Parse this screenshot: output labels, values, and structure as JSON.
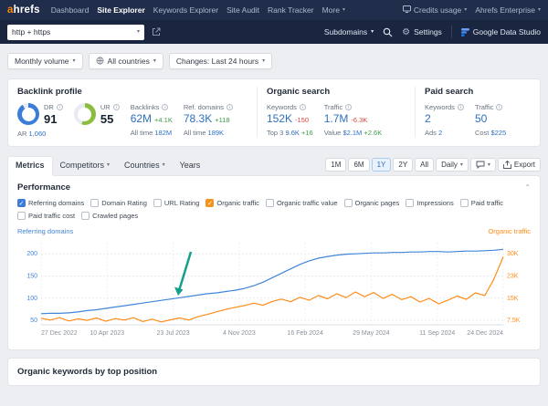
{
  "colors": {
    "accent_orange": "#ff8a00",
    "link_blue": "#2e6fc0",
    "nav_bg": "#212e4b",
    "positive_green": "#3f9b45",
    "negative_red": "#d64541"
  },
  "navbar": {
    "logo_a": "a",
    "logo_rest": "hrefs",
    "items": [
      {
        "label": "Dashboard"
      },
      {
        "label": "Site Explorer",
        "active": true
      },
      {
        "label": "Keywords Explorer"
      },
      {
        "label": "Site Audit"
      },
      {
        "label": "Rank Tracker"
      },
      {
        "label": "More",
        "caret": true
      }
    ],
    "right_items": [
      {
        "label": "Credits usage",
        "caret": true,
        "icon": "screen"
      },
      {
        "label": "Ahrefs Enterprise",
        "caret": true
      }
    ]
  },
  "toolbar": {
    "url_mode": "http + https",
    "scope": "Subdomains",
    "settings_label": "Settings",
    "gds_label": "Google Data Studio"
  },
  "filters": [
    {
      "label": "Monthly volume"
    },
    {
      "label": "All countries",
      "icon": "globe"
    },
    {
      "label": "Changes: Last 24 hours"
    }
  ],
  "overview": {
    "backlink_profile": {
      "title": "Backlink profile",
      "dr_label": "DR",
      "dr_value": "91",
      "dr_percent": 91,
      "dr_color": "#3b7dd8",
      "ar_label": "AR",
      "ar_value": "1,060",
      "ur_label": "UR",
      "ur_value": "55",
      "ur_percent": 55,
      "ur_color": "#8bbd3f",
      "backlinks_label": "Backlinks",
      "backlinks_value": "62M",
      "backlinks_delta": "+4.1K",
      "backlinks_alltime_label": "All time",
      "backlinks_alltime": "182M",
      "refdomains_label": "Ref. domains",
      "refdomains_value": "78.3K",
      "refdomains_delta": "+118",
      "refdomains_alltime_label": "All time",
      "refdomains_alltime": "189K"
    },
    "organic_search": {
      "title": "Organic search",
      "keywords_label": "Keywords",
      "keywords_value": "152K",
      "keywords_delta": "-150",
      "keywords_sub_label": "Top 3",
      "keywords_sub_value": "9.6K",
      "keywords_sub_delta": "+16",
      "traffic_label": "Traffic",
      "traffic_value": "1.7M",
      "traffic_delta": "-6.3K",
      "traffic_sub_label": "Value",
      "traffic_sub_value": "$2.1M",
      "traffic_sub_delta": "+2.6K"
    },
    "paid_search": {
      "title": "Paid search",
      "keywords_label": "Keywords",
      "keywords_value": "2",
      "keywords_sub_label": "Ads",
      "keywords_sub_value": "2",
      "traffic_label": "Traffic",
      "traffic_value": "50",
      "traffic_sub_label": "Cost",
      "traffic_sub_value": "$225"
    }
  },
  "tabs": [
    {
      "label": "Metrics",
      "active": true
    },
    {
      "label": "Competitors",
      "caret": true
    },
    {
      "label": "Countries",
      "caret": true
    },
    {
      "label": "Years"
    }
  ],
  "chart_controls": {
    "ranges": [
      "1M",
      "6M",
      "1Y",
      "2Y",
      "All"
    ],
    "active_range": "1Y",
    "granularity": "Daily",
    "export_label": "Export"
  },
  "performance": {
    "title": "Performance",
    "checkboxes": [
      {
        "label": "Referring domains",
        "checked": true,
        "color": "#3b7dd8"
      },
      {
        "label": "Domain Rating",
        "checked": false
      },
      {
        "label": "URL Rating",
        "checked": false
      },
      {
        "label": "Organic traffic",
        "checked": true,
        "color": "#f5921e"
      },
      {
        "label": "Organic traffic value",
        "checked": false
      },
      {
        "label": "Organic pages",
        "checked": false
      },
      {
        "label": "Impressions",
        "checked": false
      },
      {
        "label": "Paid traffic",
        "checked": false
      },
      {
        "label": "Paid traffic cost",
        "checked": false
      },
      {
        "label": "Crawled pages",
        "checked": false
      }
    ]
  },
  "chart_data": {
    "type": "line",
    "x_labels": [
      "27 Dec 2022",
      "10 Apr 2023",
      "23 Jul 2023",
      "4 Nov 2023",
      "16 Feb 2024",
      "29 May 2024",
      "11 Sep 2024",
      "24 Dec 2024"
    ],
    "left_axis": {
      "label": "Referring domains",
      "color": "#4285d8",
      "ticks": [
        50,
        100,
        150,
        200
      ],
      "range": [
        40,
        225
      ]
    },
    "right_axis": {
      "label": "Organic traffic",
      "color": "#ff8c1a",
      "ticks": [
        "7.5K",
        "15K",
        "23K",
        "30K"
      ],
      "range": [
        6,
        33.75
      ]
    },
    "series": [
      {
        "name": "Referring domains",
        "axis": "left",
        "color": "#4285d8",
        "values": [
          65,
          66,
          66,
          67,
          69,
          72,
          74,
          77,
          80,
          83,
          86,
          89,
          92,
          95,
          98,
          101,
          104,
          107,
          110,
          112,
          115,
          118,
          122,
          128,
          136,
          146,
          156,
          166,
          176,
          184,
          190,
          194,
          197,
          199,
          200,
          201,
          202,
          202,
          203,
          203,
          204,
          204,
          205,
          205,
          204,
          205,
          206,
          206,
          207,
          208,
          210
        ]
      },
      {
        "name": "Organic traffic",
        "axis": "right",
        "color": "#ff8c1a",
        "unit": "K",
        "values": [
          8.2,
          7.6,
          8.4,
          7.3,
          8.0,
          7.5,
          8.3,
          7.2,
          8.1,
          7.6,
          8.4,
          7.1,
          7.9,
          7.0,
          7.7,
          8.3,
          7.6,
          8.8,
          9.5,
          10.4,
          11.2,
          11.9,
          12.5,
          13.3,
          12.6,
          13.9,
          14.7,
          13.8,
          15.3,
          14.3,
          15.9,
          14.8,
          16.5,
          15.2,
          17.1,
          15.5,
          16.9,
          14.9,
          16.3,
          14.5,
          15.5,
          13.7,
          14.9,
          13.1,
          14.3,
          15.7,
          14.6,
          16.8,
          15.9,
          21.5,
          29.0
        ]
      }
    ]
  },
  "bottom": {
    "title": "Organic keywords by top position"
  }
}
